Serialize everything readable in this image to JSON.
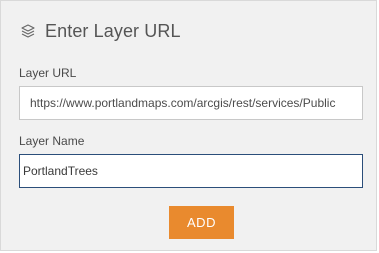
{
  "dialog": {
    "title": "Enter Layer URL",
    "title_icon": "layers-icon"
  },
  "fields": {
    "url": {
      "label": "Layer URL",
      "value": "https://www.portlandmaps.com/arcgis/rest/services/Public"
    },
    "name": {
      "label": "Layer Name",
      "value": "PortlandTrees"
    }
  },
  "actions": {
    "add_label": "ADD"
  },
  "colors": {
    "accent": "#e98a2e",
    "focus_border": "#2b4e7a"
  }
}
